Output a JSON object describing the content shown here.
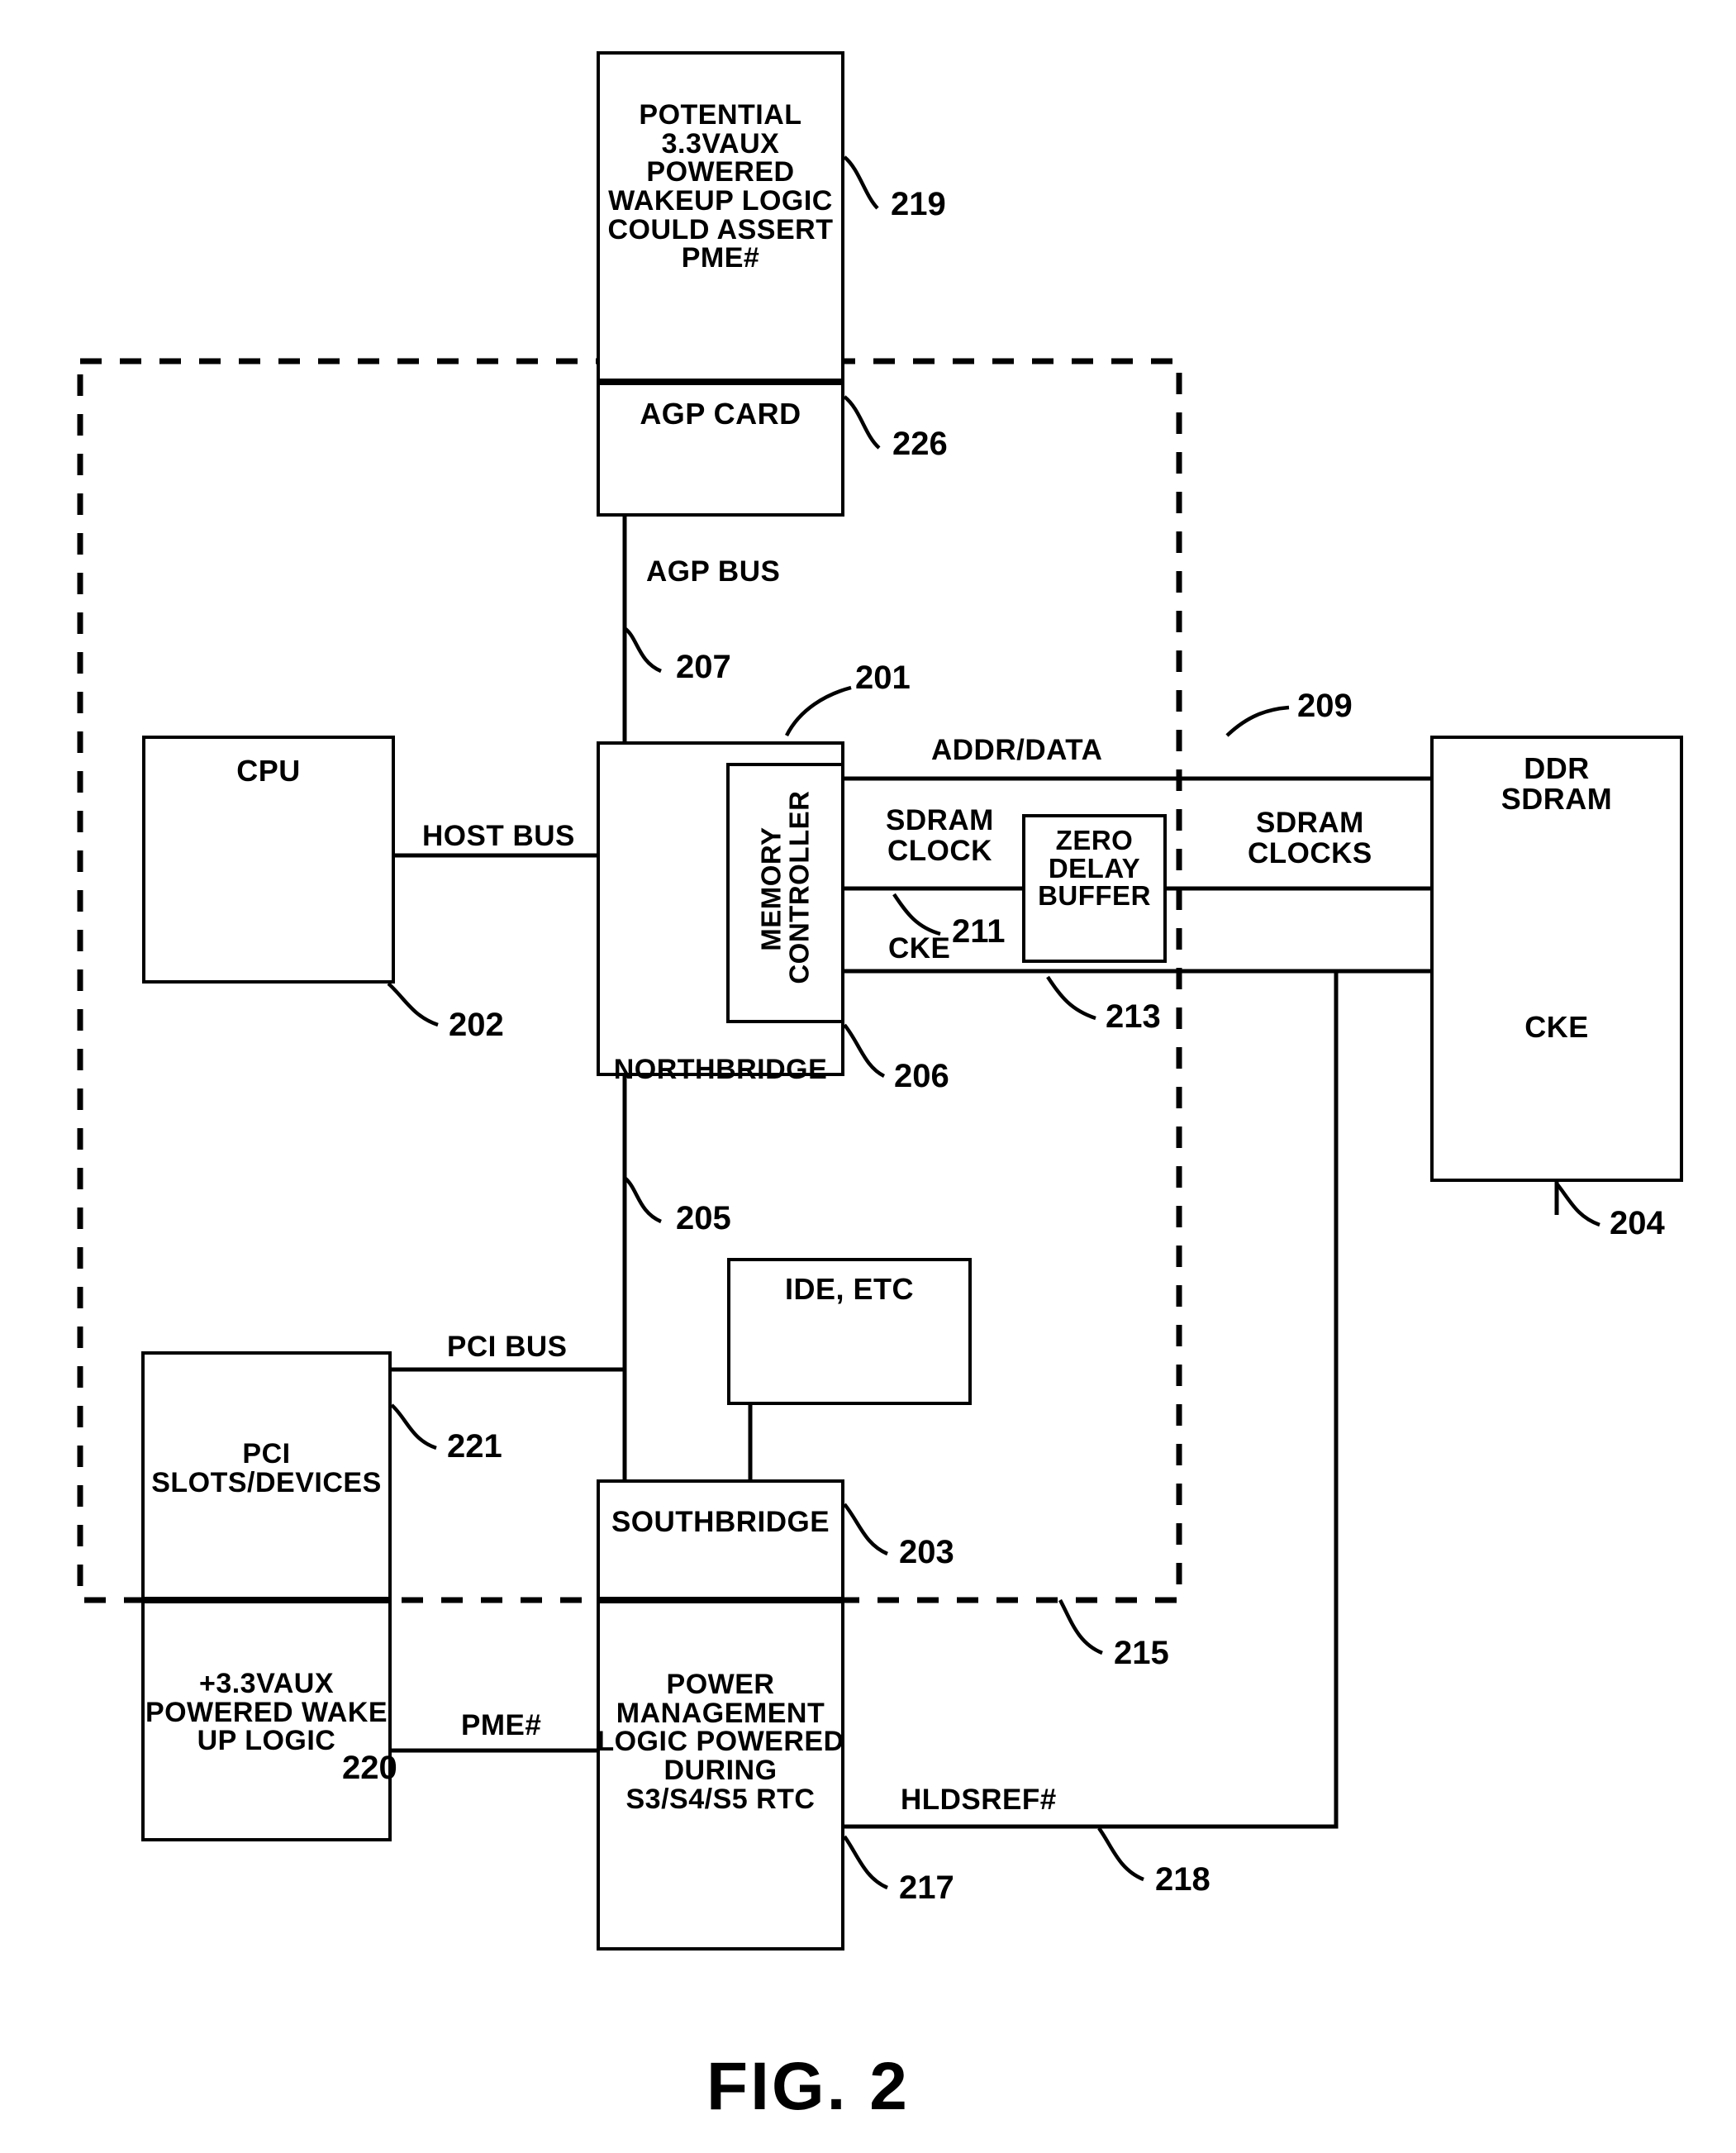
{
  "figure": {
    "caption": "FIG. 2"
  },
  "boundary": {
    "name": "motherboard-boundary",
    "style": "dashed"
  },
  "blocks": {
    "potential_wakeup": {
      "label": "POTENTIAL\n3.3VAUX\nPOWERED\nWAKEUP LOGIC\nCOULD ASSERT\nPME#",
      "ref": "219"
    },
    "agp_card": {
      "label": "AGP CARD",
      "ref": "226"
    },
    "cpu": {
      "label": "CPU",
      "ref": "202"
    },
    "northbridge": {
      "label": "NORTHBRIDGE",
      "ref": "201"
    },
    "memory_controller": {
      "label": "MEMORY\nCONTROLLER",
      "ref": "206"
    },
    "zero_delay_buffer": {
      "label": "ZERO\nDELAY\nBUFFER"
    },
    "ddr_sdram": {
      "label": "DDR\nSDRAM",
      "sublabel": "CKE",
      "ref": "204"
    },
    "ide_etc": {
      "label": "IDE, ETC"
    },
    "pci_slots": {
      "label": "PCI\nSLOTS/DEVICES",
      "ref": "221"
    },
    "aux_wake_logic": {
      "label": "+3.3VAUX\nPOWERED WAKE\nUP LOGIC",
      "ref": "220"
    },
    "southbridge": {
      "label": "SOUTHBRIDGE",
      "ref": "203"
    },
    "power_mgmt": {
      "label": "POWER\nMANAGEMENT\nLOGIC POWERED\nDURING\nS3/S4/S5 RTC",
      "ref": "217"
    }
  },
  "signals": {
    "agp_bus": {
      "label": "AGP BUS",
      "ref": "207"
    },
    "host_bus": {
      "label": "HOST BUS"
    },
    "addr_data": {
      "label": "ADDR/DATA",
      "ref": "209"
    },
    "sdram_clock": {
      "label": "SDRAM\nCLOCK",
      "ref": "211"
    },
    "sdram_clocks": {
      "label": "SDRAM\nCLOCKS"
    },
    "cke": {
      "label": "CKE",
      "ref": "213"
    },
    "pci_bus": {
      "label": "PCI BUS",
      "ref": "205"
    },
    "pme": {
      "label": "PME#"
    },
    "hldsref": {
      "label": "HLDSREF#",
      "ref": "218"
    },
    "boundary_ref": {
      "ref": "215"
    }
  }
}
